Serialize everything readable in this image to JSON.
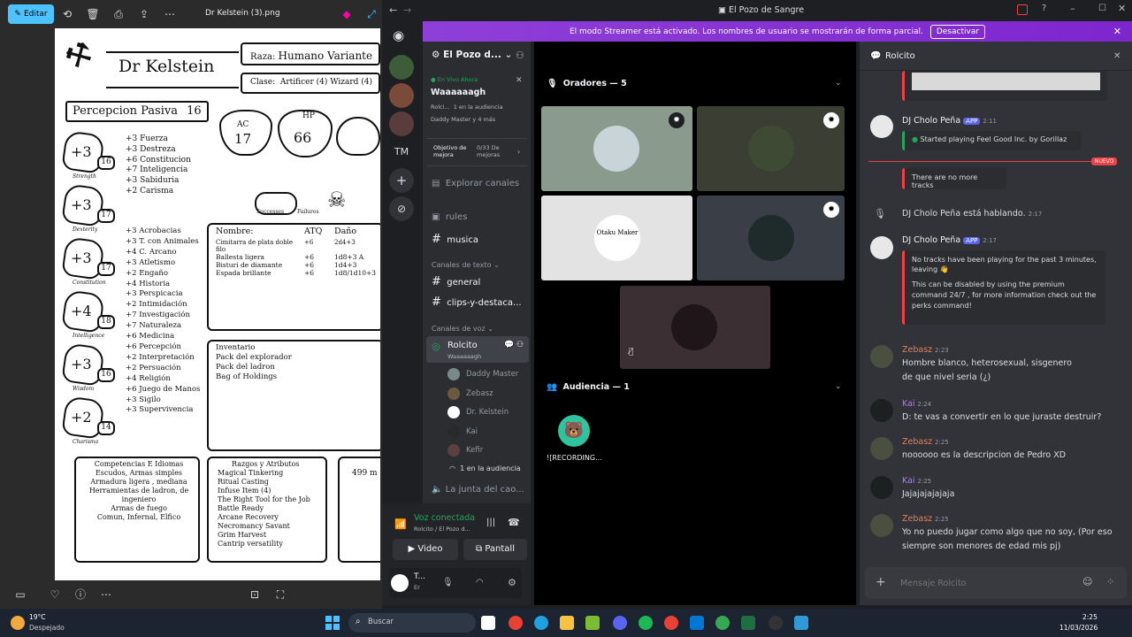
{
  "viewer": {
    "edit_label": "Editar",
    "file_title": "Dr Kelstein (3).png"
  },
  "sheet": {
    "name": "Dr Kelstein",
    "race_label": "Raza:",
    "race": "Humano Variante",
    "class_label": "Clase:",
    "class": "Artificer (4) Wizard (4)",
    "passive": "Percepcion Pasiva",
    "passive_val": "16",
    "ac_label": "AC",
    "ac": "17",
    "hp_label": "HP",
    "hp": "66",
    "successes": "Successes",
    "failures": "Failures",
    "abilities": [
      {
        "mod": "+3",
        "score": "16",
        "name": "Strength"
      },
      {
        "mod": "+3",
        "score": "17",
        "name": "Dexterity"
      },
      {
        "mod": "+3",
        "score": "17",
        "name": "Constitution"
      },
      {
        "mod": "+4",
        "score": "18",
        "name": "Intelligence"
      },
      {
        "mod": "+3",
        "score": "16",
        "name": "Wisdom"
      },
      {
        "mod": "+2",
        "score": "14",
        "name": "Charisma"
      }
    ],
    "saves": [
      "+3 Fuerza",
      "+3 Destreza",
      "+6 Constitucion",
      "+7 Inteligencia",
      "+3 Sabiduria",
      "+2 Carisma"
    ],
    "skills": [
      "+3 Acrobacias",
      "+3 T. con Animales",
      "+4 C. Arcano",
      "+3 Atletismo",
      "+2 Engaño",
      "+4 Historia",
      "+3 Perspicacia",
      "+2 Intimidación",
      "+7 Investigación",
      "+7 Naturaleza",
      "+6 Medicina",
      "+6 Percepción",
      "+2 Interpretación",
      "+2 Persuación",
      "+4 Religión",
      "+6 Juego de Manos",
      "+3 Sigilo",
      "+3 Supervivencia"
    ],
    "attack_headers": [
      "Nombre:",
      "ATQ",
      "Daño"
    ],
    "attacks": [
      [
        "Cimitarra de plata doble filo",
        "+6",
        "2d4+3"
      ],
      [
        "Ballesta ligera",
        "+6",
        "1d8+3 A"
      ],
      [
        "Bisturi de diamante",
        "+6",
        "1d4+3"
      ],
      [
        "Espada brillante",
        "+6",
        "1d8/1d10+3"
      ]
    ],
    "inventory_title": "Inventario",
    "inventory": [
      "Pack del explorador",
      "Pack del ladron",
      "Bag of Holdings"
    ],
    "prof_title": "Competencias E Idiomas",
    "prof": [
      "Escudos, Armas simples",
      "Armadura ligera , mediana",
      "Herramientas de ladron, de ingeniero",
      "Armas de fuego",
      "Comun, Infernal, Elfico"
    ],
    "traits_title": "Razgos y Atributos",
    "traits": [
      "Magical Tinkering",
      "Ritual Casting",
      "Infuse Item (4)",
      "The Right Tool for the Job",
      "Battle Ready",
      "Arcane Recovery",
      "Necromancy Savant",
      "Grim Harvest",
      "Cantrip versatility"
    ],
    "gold": "499 m"
  },
  "discord": {
    "window_title": "El Pozo de Sangre",
    "banner_text": "El modo Streamer está activado. Los nombres de usuario se mostrarán de forma parcial.",
    "banner_button": "Desactivar",
    "rail_tm": "TM",
    "server_name": "El Pozo d...",
    "live_label": "En Vivo Ahora",
    "stage_name": "Waaaaaagh",
    "live_host": "Rolci...",
    "live_audience": "1 en la audiencia",
    "live_speaker": "Daddy Master y 4 más",
    "boost_label": "Objetivo de mejora",
    "boost_value": "0/33 De mejoras",
    "explore": "Explorar canales",
    "channels": {
      "rules": "rules",
      "musica": "musica",
      "text_cat": "Canales de texto",
      "general": "general",
      "clips": "clips-y-destaca...",
      "voice_cat": "Canales de voz",
      "rolcito": "Rolcito",
      "rolcito_sub": "Waaaaaagh",
      "members": [
        "Daddy Master",
        "Zebasz",
        "Dr. Kelstein",
        "Kai",
        "Kefir"
      ],
      "audience": "1 en la audiencia",
      "junta": "La junta del cao..."
    },
    "voice": {
      "status": "Voz conectada",
      "sub": "Rolcito / El Pozo d...",
      "video": "Video",
      "screen": "Pantall"
    },
    "user": {
      "name": "T...",
      "status": "Er"
    },
    "speakers_header": "Oradores — 5",
    "audience_header": "Audiencia — 1",
    "recording_name": "![RECORDING...",
    "otaku_label": "Otaku Maker",
    "chat_header": "Rolcito",
    "messages": [
      {
        "author": "DJ Cholo Peña",
        "badge": "APP",
        "time": "2:11",
        "embed": "Started playing Feel Good Inc. by Gorillaz"
      },
      {
        "new_label": "NUEVO",
        "embed": "There are no more tracks"
      },
      {
        "system": "DJ Cholo Peña está hablando.",
        "time": "2:17"
      },
      {
        "author": "DJ Cholo Peña",
        "badge": "APP",
        "time": "2:17",
        "embed1": "No tracks have been playing for the past 3 minutes, leaving 👋",
        "embed2": "This can be disabled by using the premium command 24/7 , for more information check out the perks command!"
      },
      {
        "author": "Zebasz",
        "time": "2:23",
        "text1": "Hombre blanco, heterosexual, sisgenero",
        "text2": "de que nivel seria (¿)"
      },
      {
        "author": "Kai",
        "time": "2:24",
        "text1": "D: te vas a convertir en lo que juraste destruir?"
      },
      {
        "author": "Zebasz",
        "time": "2:25",
        "text1": "noooooo es la descripcion de Pedro XD"
      },
      {
        "author": "Kai",
        "time": "2:25",
        "text1": "Jajajajajajaja"
      },
      {
        "author": "Zebasz",
        "time": "2:25",
        "text1": "Yo no puedo jugar como algo que no soy, (Por eso",
        "text2": "siempre son menores de edad mis pj)"
      }
    ],
    "input_placeholder": "Mensaje Rolcito"
  },
  "taskbar": {
    "weather_temp": "19°C",
    "weather_desc": "Despejado",
    "search": "Buscar",
    "time": "2:25",
    "date": "11/03/2026"
  },
  "colors": {
    "accent": "#5865f2",
    "streamer_banner": "#8f3fd9",
    "zebasz": "#e67e5a",
    "kai": "#b07cf2",
    "green": "#23a55a"
  }
}
